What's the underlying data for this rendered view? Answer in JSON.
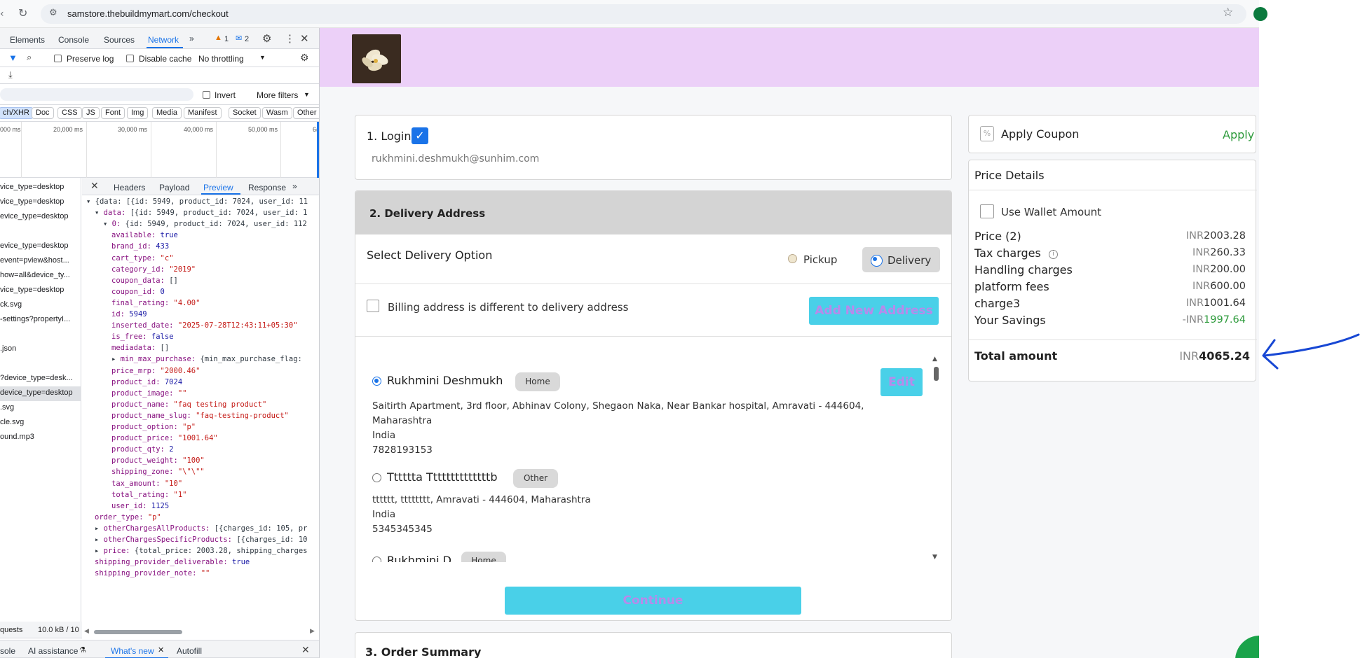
{
  "browser": {
    "url": "samstore.thebuildmymart.com/checkout"
  },
  "devtools": {
    "tabs": [
      "Elements",
      "Console",
      "Sources",
      "Network"
    ],
    "warn_count": "1",
    "info_count": "2",
    "preserve_log": "Preserve log",
    "disable_cache": "Disable cache",
    "throttling": "No throttling",
    "invert": "Invert",
    "more_filters": "More filters",
    "filters": [
      "ch/XHR",
      "Doc",
      "CSS",
      "JS",
      "Font",
      "Img",
      "Media",
      "Manifest",
      "Socket",
      "Wasm",
      "Other"
    ],
    "timeline": [
      "000 ms",
      "20,000 ms",
      "30,000 ms",
      "40,000 ms",
      "50,000 ms",
      "6("
    ],
    "detail_tabs": [
      "Headers",
      "Payload",
      "Preview",
      "Response"
    ],
    "requests": [
      "vice_type=desktop",
      "vice_type=desktop",
      "evice_type=desktop",
      "",
      "evice_type=desktop",
      "event=pview&host...",
      "how=all&device_ty...",
      "vice_type=desktop",
      "ck.svg",
      "-settings?propertyI...",
      "",
      ".json",
      "",
      "?device_type=desk...",
      "device_type=desktop",
      ".svg",
      "cle.svg",
      "ound.mp3"
    ],
    "json_lines": [
      {
        "i": 0,
        "t": "▾",
        "k": "",
        "v": "{data: [{id: 5949, product_id: 7024, user_id: 11",
        "c": "p"
      },
      {
        "i": 1,
        "t": "▾",
        "k": "data:",
        "v": "[{id: 5949, product_id: 7024, user_id: 1",
        "c": "p"
      },
      {
        "i": 2,
        "t": "▾",
        "k": "0:",
        "v": "{id: 5949, product_id: 7024, user_id: 112",
        "c": "p"
      },
      {
        "i": 3,
        "t": "",
        "k": "available:",
        "v": "true",
        "c": "n"
      },
      {
        "i": 3,
        "t": "",
        "k": "brand_id:",
        "v": "433",
        "c": "n"
      },
      {
        "i": 3,
        "t": "",
        "k": "cart_type:",
        "v": "\"c\"",
        "c": "s"
      },
      {
        "i": 3,
        "t": "",
        "k": "category_id:",
        "v": "\"2019\"",
        "c": "s"
      },
      {
        "i": 3,
        "t": "",
        "k": "coupon_data:",
        "v": "[]",
        "c": "p"
      },
      {
        "i": 3,
        "t": "",
        "k": "coupon_id:",
        "v": "0",
        "c": "n"
      },
      {
        "i": 3,
        "t": "",
        "k": "final_rating:",
        "v": "\"4.00\"",
        "c": "s"
      },
      {
        "i": 3,
        "t": "",
        "k": "id:",
        "v": "5949",
        "c": "n"
      },
      {
        "i": 3,
        "t": "",
        "k": "inserted_date:",
        "v": "\"2025-07-28T12:43:11+05:30\"",
        "c": "s"
      },
      {
        "i": 3,
        "t": "",
        "k": "is_free:",
        "v": "false",
        "c": "n"
      },
      {
        "i": 3,
        "t": "",
        "k": "mediadata:",
        "v": "[]",
        "c": "p"
      },
      {
        "i": 3,
        "t": "▸",
        "k": "min_max_purchase:",
        "v": "{min_max_purchase_flag: ",
        "c": "p"
      },
      {
        "i": 3,
        "t": "",
        "k": "price_mrp:",
        "v": "\"2000.46\"",
        "c": "s"
      },
      {
        "i": 3,
        "t": "",
        "k": "product_id:",
        "v": "7024",
        "c": "n"
      },
      {
        "i": 3,
        "t": "",
        "k": "product_image:",
        "v": "\"\"",
        "c": "s"
      },
      {
        "i": 3,
        "t": "",
        "k": "product_name:",
        "v": "\"faq testing product\"",
        "c": "s"
      },
      {
        "i": 3,
        "t": "",
        "k": "product_name_slug:",
        "v": "\"faq-testing-product\"",
        "c": "s"
      },
      {
        "i": 3,
        "t": "",
        "k": "product_option:",
        "v": "\"p\"",
        "c": "s"
      },
      {
        "i": 3,
        "t": "",
        "k": "product_price:",
        "v": "\"1001.64\"",
        "c": "s"
      },
      {
        "i": 3,
        "t": "",
        "k": "product_qty:",
        "v": "2",
        "c": "n"
      },
      {
        "i": 3,
        "t": "",
        "k": "product_weight:",
        "v": "\"100\"",
        "c": "s"
      },
      {
        "i": 3,
        "t": "",
        "k": "shipping_zone:",
        "v": "\"\\\"\\\"\"",
        "c": "s"
      },
      {
        "i": 3,
        "t": "",
        "k": "tax_amount:",
        "v": "\"10\"",
        "c": "s"
      },
      {
        "i": 3,
        "t": "",
        "k": "total_rating:",
        "v": "\"1\"",
        "c": "s"
      },
      {
        "i": 3,
        "t": "",
        "k": "user_id:",
        "v": "1125",
        "c": "n"
      },
      {
        "i": 1,
        "t": "",
        "k": "order_type:",
        "v": "\"p\"",
        "c": "s"
      },
      {
        "i": 1,
        "t": "▸",
        "k": "otherChargesAllProducts:",
        "v": "[{charges_id: 105, pr",
        "c": "p"
      },
      {
        "i": 1,
        "t": "▸",
        "k": "otherChargesSpecificProducts:",
        "v": "[{charges_id: 10",
        "c": "p"
      },
      {
        "i": 1,
        "t": "▸",
        "k": "price:",
        "v": "{total_price: 2003.28, shipping_charges",
        "c": "p"
      },
      {
        "i": 1,
        "t": "",
        "k": "shipping_provider_deliverable:",
        "v": "true",
        "c": "n"
      },
      {
        "i": 1,
        "t": "",
        "k": "shipping_provider_note:",
        "v": "\"\"",
        "c": "s"
      }
    ],
    "status": {
      "requests": "quests",
      "size": "10.0 kB / 10"
    },
    "drawer_tabs": [
      "sole",
      "AI assistance",
      "What's new",
      "Autofill"
    ]
  },
  "checkout": {
    "login": {
      "title": "1. Login",
      "email": "rukhmini.deshmukh@sunhim.com"
    },
    "delivery": {
      "title": "2. Delivery Address",
      "select_option": "Select Delivery Option",
      "pickup": "Pickup",
      "delivery": "Delivery",
      "billing_label": "Billing address is different to delivery address",
      "add_new": "Add New Address",
      "edit": "Edit",
      "addresses": [
        {
          "name": "Rukhmini Deshmukh",
          "tag": "Home",
          "lines": [
            "Saitirth Apartment, 3rd floor, Abhinav Colony, Shegaon Naka, Near Bankar hospital, Amravati - 444604,",
            "Maharashtra",
            "India",
            "7828193153"
          ],
          "selected": true
        },
        {
          "name": "Tttttta Ttttttttttttttb",
          "tag": "Other",
          "lines": [
            "tttttt, tttttttt, Amravati - 444604, Maharashtra",
            "India",
            "5345345345"
          ],
          "selected": false
        },
        {
          "name": "Rukhmini D",
          "tag": "Home",
          "lines": [],
          "selected": false
        }
      ],
      "continue": "Continue"
    },
    "order_summary": {
      "title": "3. Order Summary"
    },
    "coupon": {
      "label": "Apply Coupon",
      "action": "Apply"
    },
    "price_details": {
      "title": "Price Details",
      "wallet": "Use Wallet Amount",
      "currency": "INR",
      "rows": [
        {
          "label": "Price (2)",
          "value": "2003.28"
        },
        {
          "label": "Tax charges",
          "value": "260.33"
        },
        {
          "label": "Handling charges",
          "value": "200.00"
        },
        {
          "label": "platform fees",
          "value": "600.00"
        },
        {
          "label": "charge3",
          "value": "1001.64"
        },
        {
          "label": "Your Savings",
          "value": "1997.64"
        }
      ],
      "savings_prefix": "-INR",
      "total_label": "Total amount",
      "total_value": "4065.24"
    }
  },
  "colors": {
    "accent_cyan": "#49d0e8",
    "banner": "#ecd0f8",
    "savings_green": "#2e9b3c",
    "annotation_blue": "#1747d4"
  }
}
